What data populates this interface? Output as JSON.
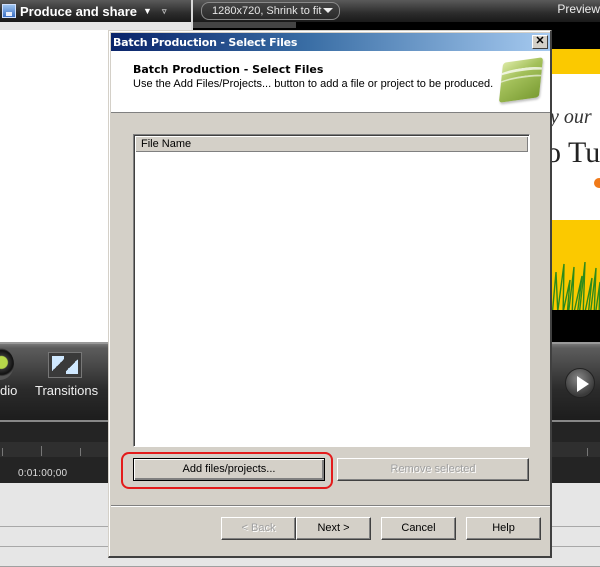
{
  "app": {
    "produce_menu": {
      "label": "Produce and share",
      "icon": "save-disk-icon"
    },
    "size_dropdown": {
      "value": "1280x720, Shrink to fit"
    },
    "preview_label": "Preview",
    "preview_text_line1": "y our",
    "preview_text_line2": "o Tu",
    "toolbar": {
      "items": [
        {
          "label": "dio",
          "icon": "audio-icon"
        },
        {
          "label": "Transitions",
          "icon": "transitions-icon"
        }
      ],
      "play_icon": "play-icon"
    },
    "timeline": {
      "timecode": "0:01:00;00"
    }
  },
  "dialog": {
    "title": "Batch Production - Select Files",
    "close_label": "✕",
    "header": {
      "title": "Batch Production - Select Files",
      "description": "Use the Add Files/Projects... button to add a file or project to be produced.",
      "logo": "camtasia-logo-icon"
    },
    "file_list": {
      "columns": [
        "File Name"
      ],
      "rows": []
    },
    "buttons": {
      "add": "Add files/projects...",
      "remove": "Remove selected",
      "back": "< Back",
      "next": "Next >",
      "cancel": "Cancel",
      "help": "Help"
    },
    "highlight_color": "#e31b1b"
  }
}
